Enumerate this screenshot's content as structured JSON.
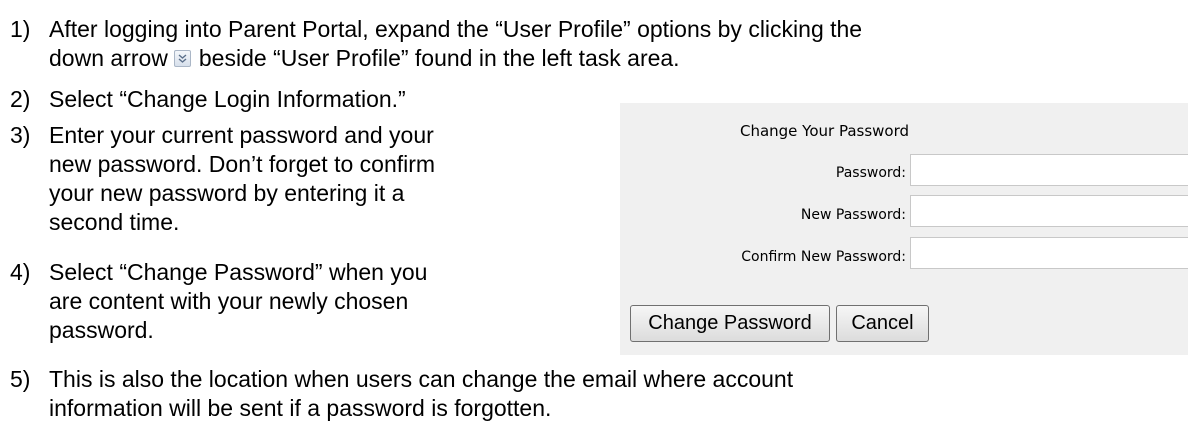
{
  "steps": [
    {
      "number": "1)",
      "line1_before": "After logging into Parent Portal, expand the “User Profile” options by clicking the",
      "line2_before": "down arrow",
      "arrow_icon": "double-chevron-down-icon",
      "line2_after": "beside “User Profile” found in the left task area."
    },
    {
      "number": "2)",
      "lines": [
        "Select “Change Login Information.”"
      ]
    },
    {
      "number": "3)",
      "lines": [
        "Enter your current password and your",
        "new password. Don’t forget to confirm",
        "your new password by entering it a",
        "second time."
      ]
    },
    {
      "number": "4)",
      "lines": [
        "Select “Change Password” when you",
        "are content with your newly chosen",
        "password."
      ]
    },
    {
      "number": "5)",
      "lines": [
        "This is also the location when users can change the email where account",
        "information will be sent if a password is forgotten."
      ]
    }
  ],
  "form": {
    "title": "Change Your Password",
    "password_label": "Password:",
    "password_value": "",
    "new_password_label": "New Password:",
    "new_password_value": "",
    "confirm_label": "Confirm New Password:",
    "confirm_value": "",
    "change_button": "Change Password",
    "cancel_button": "Cancel",
    "panel_color": "#f0f0f0"
  }
}
